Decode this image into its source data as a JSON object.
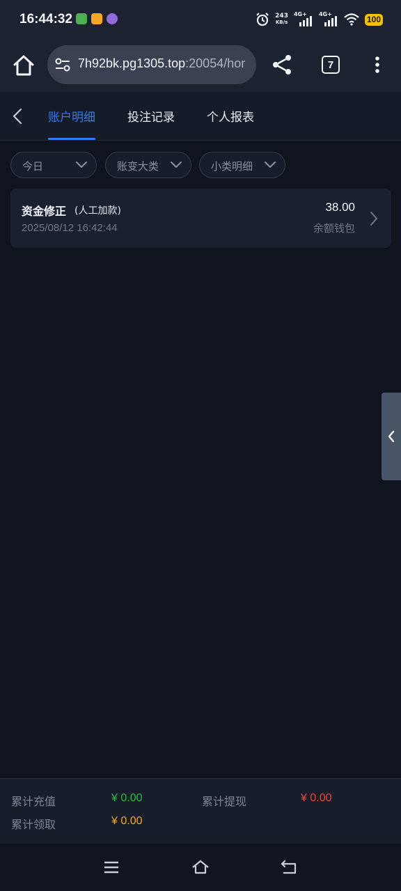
{
  "status_bar": {
    "time": "16:44:32",
    "net_speed": "243",
    "net_unit": "KB/s",
    "signal1_label": "4G+",
    "signal2_label": "4G+",
    "battery": "100"
  },
  "browser": {
    "url_host": "7h92bk.pg1305.top",
    "url_path": ":20054/hor",
    "tab_count": "7"
  },
  "header": {
    "tabs": [
      {
        "label": "账户明细",
        "active": true
      },
      {
        "label": "投注记录",
        "active": false
      },
      {
        "label": "个人报表",
        "active": false
      }
    ]
  },
  "filters": [
    {
      "label": "今日"
    },
    {
      "label": "账变大类"
    },
    {
      "label": "小类明细"
    }
  ],
  "records": [
    {
      "title": "资金修正",
      "subtype": "(人工加款)",
      "datetime": "2025/08/12 16:42:44",
      "amount": "38.00",
      "wallet": "余额钱包"
    }
  ],
  "summary": {
    "deposit_label": "累计充值",
    "deposit_value": "¥ 0.00",
    "withdraw_label": "累计提现",
    "withdraw_value": "¥ 0.00",
    "claim_label": "累计领取",
    "claim_value": "¥ 0.00"
  },
  "colors": {
    "accent": "#2f7cf6",
    "deposit": "#23c03f",
    "withdraw": "#f0453a",
    "claim": "#f5a623",
    "background": "#0f141e"
  }
}
